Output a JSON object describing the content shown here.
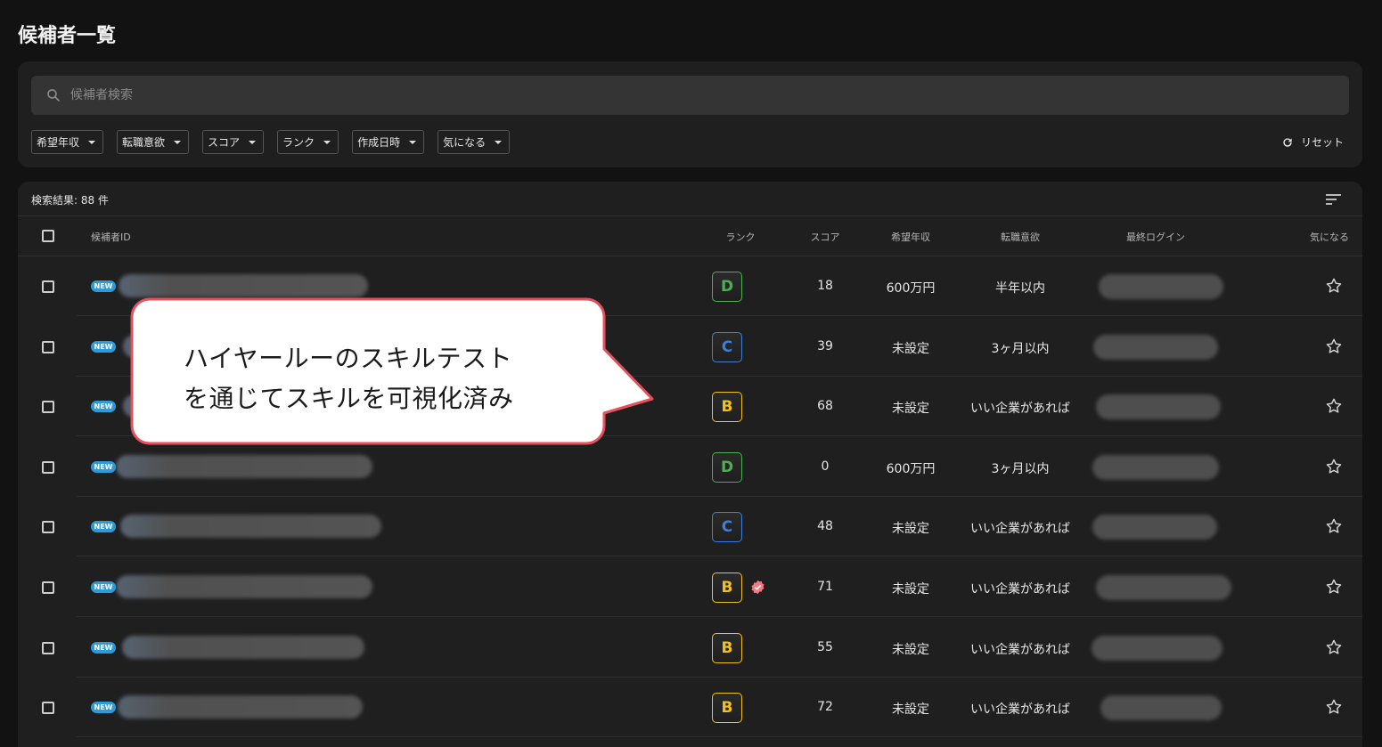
{
  "page_title": "候補者一覧",
  "search": {
    "placeholder": "候補者検索",
    "value": ""
  },
  "filters": [
    "希望年収",
    "転職意欲",
    "スコア",
    "ランク",
    "作成日時",
    "気になる"
  ],
  "reset_label": "リセット",
  "results_count": "検索結果: 88 件",
  "columns": {
    "candidate_id": "候補者ID",
    "rank": "ランク",
    "score": "スコア",
    "salary": "希望年収",
    "motivation": "転職意欲",
    "last_login": "最終ログイン",
    "favorite": "気になる"
  },
  "new_badge": "NEW",
  "rank_colors": {
    "D": "#4caf50",
    "C": "#3f7fd8",
    "B": "#f2c21b"
  },
  "rows": [
    {
      "rank": "D",
      "score": "18",
      "salary": "600万円",
      "motivation": "半年以内",
      "verified": false
    },
    {
      "rank": "C",
      "score": "39",
      "salary": "未設定",
      "motivation": "3ヶ月以内",
      "verified": false
    },
    {
      "rank": "B",
      "score": "68",
      "salary": "未設定",
      "motivation": "いい企業があれば",
      "verified": false
    },
    {
      "rank": "D",
      "score": "0",
      "salary": "600万円",
      "motivation": "3ヶ月以内",
      "verified": false
    },
    {
      "rank": "C",
      "score": "48",
      "salary": "未設定",
      "motivation": "いい企業があれば",
      "verified": false
    },
    {
      "rank": "B",
      "score": "71",
      "salary": "未設定",
      "motivation": "いい企業があれば",
      "verified": true
    },
    {
      "rank": "B",
      "score": "55",
      "salary": "未設定",
      "motivation": "いい企業があれば",
      "verified": false
    },
    {
      "rank": "B",
      "score": "72",
      "salary": "未設定",
      "motivation": "いい企業があれば",
      "verified": false
    }
  ],
  "callout": {
    "line1": "ハイヤールーのスキルテスト",
    "line2": "を通じてスキルを可視化済み"
  }
}
